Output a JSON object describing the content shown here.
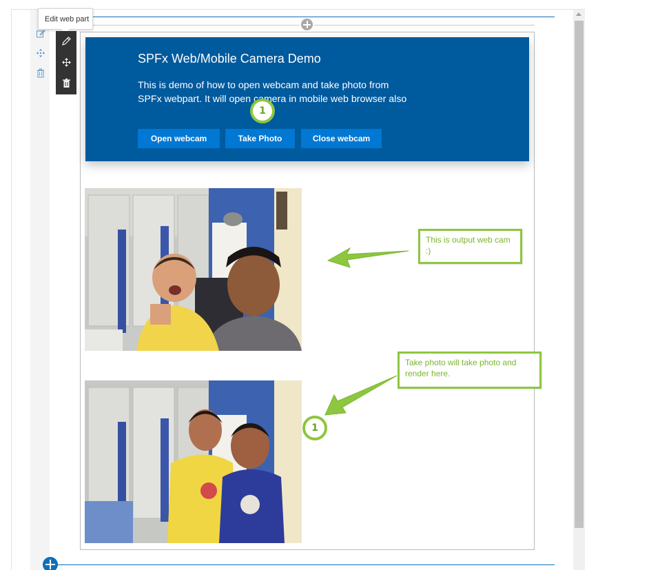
{
  "tooltip": {
    "text": "Edit web part"
  },
  "section_toolbar": {
    "items": [
      {
        "icon": "edit-icon"
      },
      {
        "icon": "move-icon"
      },
      {
        "icon": "delete-icon"
      }
    ]
  },
  "webpart_toolbar": {
    "items": [
      {
        "icon": "pencil-icon"
      },
      {
        "icon": "move-icon"
      },
      {
        "icon": "trash-icon"
      }
    ]
  },
  "demo": {
    "title": "SPFx Web/Mobile Camera Demo",
    "description": "This is demo of how to open webcam and take photo from SPFx webpart. It will open camera in mobile web browser also",
    "buttons": {
      "open": "Open webcam",
      "take": "Take Photo",
      "close": "Close webcam"
    }
  },
  "annotations": {
    "webcam_output": "This is output web cam :)",
    "take_photo_output": "Take photo will take photo and render here.",
    "marker_top": "1",
    "marker_bottom": "1"
  },
  "colors": {
    "accent_blue": "#0078d4",
    "panel_blue": "#005a9e",
    "annotation_green": "#8dc63f"
  }
}
